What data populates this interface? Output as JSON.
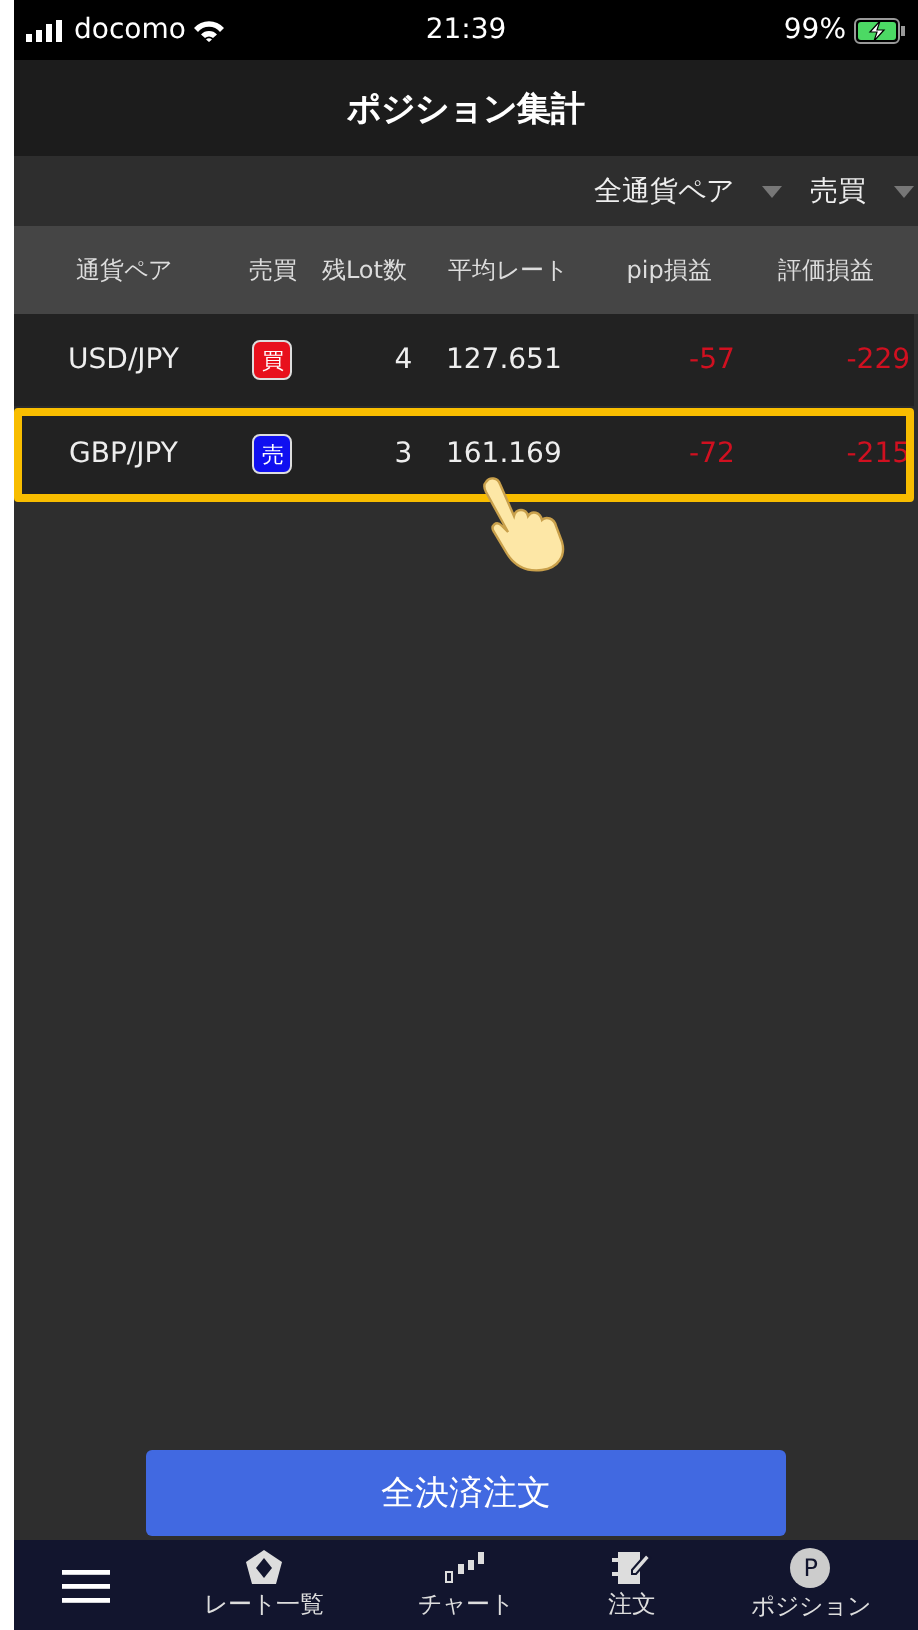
{
  "status_bar": {
    "carrier": "docomo",
    "time": "21:39",
    "battery": "99%"
  },
  "title": "ポジション集計",
  "filters": [
    {
      "label": "全通貨ペア"
    },
    {
      "label": "売買"
    }
  ],
  "table": {
    "columns": [
      "通貨ペア",
      "売買",
      "残Lot数",
      "平均レート",
      "pip損益",
      "評価損益"
    ],
    "rows": [
      {
        "pair": "USD/JPY",
        "kind": "buy",
        "side_label": "買",
        "lots": "4",
        "rate": "127.651",
        "pips": "-57",
        "pnl": "-229",
        "highlighted": false
      },
      {
        "pair": "GBP/JPY",
        "kind": "sell",
        "side_label": "売",
        "lots": "3",
        "rate": "161.169",
        "pips": "-72",
        "pnl": "-215",
        "highlighted": true
      }
    ]
  },
  "close_all_button": "全決済注文",
  "nav": [
    {
      "kind": "menu"
    },
    {
      "kind": "rates",
      "label": "レート一覧"
    },
    {
      "kind": "chart",
      "label": "チャート"
    },
    {
      "kind": "order",
      "label": "注文"
    },
    {
      "kind": "position",
      "label": "ポジション",
      "icon_text": "P"
    }
  ]
}
